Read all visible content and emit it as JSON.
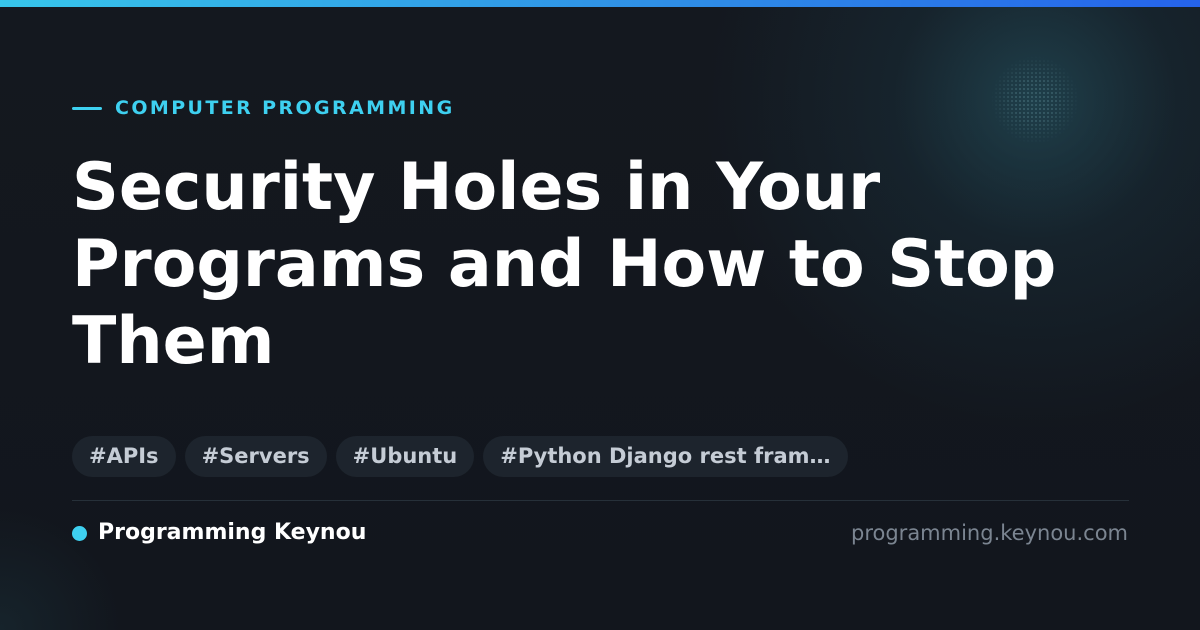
{
  "colors": {
    "accent": "#3ed0f0",
    "background": "#12161d",
    "tag_background": "#1d242d",
    "title": "#ffffff",
    "url": "#7b8591"
  },
  "card": {
    "category": "COMPUTER PROGRAMMING",
    "title": "Security Holes in Your Programs and How to Stop Them",
    "tags": [
      "#APIs",
      "#Servers",
      "#Ubuntu",
      "#Python Django rest fram…"
    ],
    "footer": {
      "brand_name": "Programming Keynou",
      "site_url": "programming.keynou.com"
    }
  }
}
